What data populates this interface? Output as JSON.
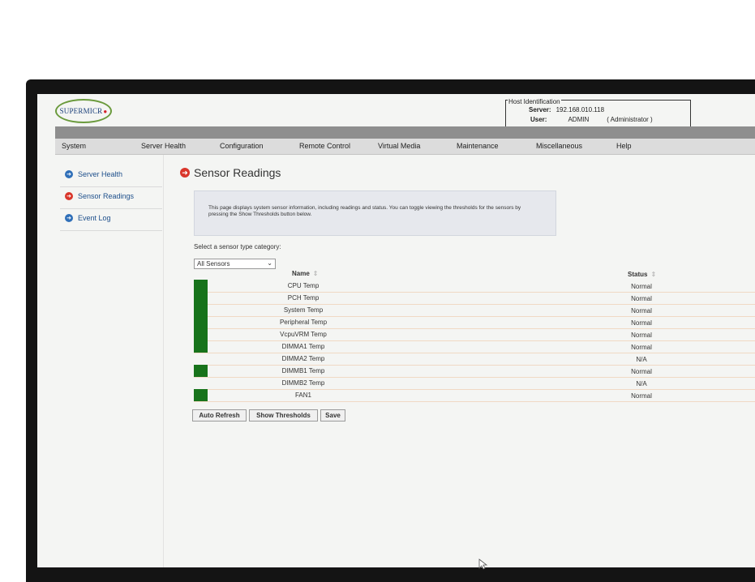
{
  "header": {
    "logo_text": "SUPERMICR",
    "host_identification_label": "Host Identification",
    "server_label": "Server:",
    "server_value": "192.168.010.118",
    "user_label": "User:",
    "user_value": "ADMIN",
    "user_role": "( Administrator )"
  },
  "menu": [
    "System",
    "Server Health",
    "Configuration",
    "Remote Control",
    "Virtual Media",
    "Maintenance",
    "Miscellaneous",
    "Help"
  ],
  "sidebar": {
    "items": [
      {
        "label": "Server Health",
        "icon": "arrow-right-circle-icon",
        "active": false
      },
      {
        "label": "Sensor Readings",
        "icon": "arrow-right-circle-icon",
        "active": true
      },
      {
        "label": "Event Log",
        "icon": "arrow-right-circle-icon",
        "active": false
      }
    ]
  },
  "page": {
    "title": "Sensor Readings",
    "info_text": "This page displays system sensor information, including readings and status. You can toggle viewing the thresholds for the sensors by pressing the Show Thresholds button below.",
    "select_label": "Select a sensor type category:",
    "select_value": "All Sensors"
  },
  "table": {
    "headers": {
      "name": "Name",
      "status": "Status"
    },
    "rows": [
      {
        "name": "CPU Temp",
        "status": "Normal",
        "indicator": true
      },
      {
        "name": "PCH Temp",
        "status": "Normal",
        "indicator": true
      },
      {
        "name": "System Temp",
        "status": "Normal",
        "indicator": true
      },
      {
        "name": "Peripheral Temp",
        "status": "Normal",
        "indicator": true
      },
      {
        "name": "VcpuVRM Temp",
        "status": "Normal",
        "indicator": true
      },
      {
        "name": "DIMMA1 Temp",
        "status": "Normal",
        "indicator": true
      },
      {
        "name": "DIMMA2 Temp",
        "status": "N/A",
        "indicator": false
      },
      {
        "name": "DIMMB1 Temp",
        "status": "Normal",
        "indicator": true
      },
      {
        "name": "DIMMB2 Temp",
        "status": "N/A",
        "indicator": false
      },
      {
        "name": "FAN1",
        "status": "Normal",
        "indicator": true
      }
    ]
  },
  "buttons": {
    "auto_refresh": "Auto Refresh",
    "show_thresholds": "Show Thresholds",
    "save": "Save"
  },
  "colors": {
    "status_ok": "#17731b",
    "active_icon": "#d9362b",
    "nav_icon": "#2f6fb8"
  }
}
